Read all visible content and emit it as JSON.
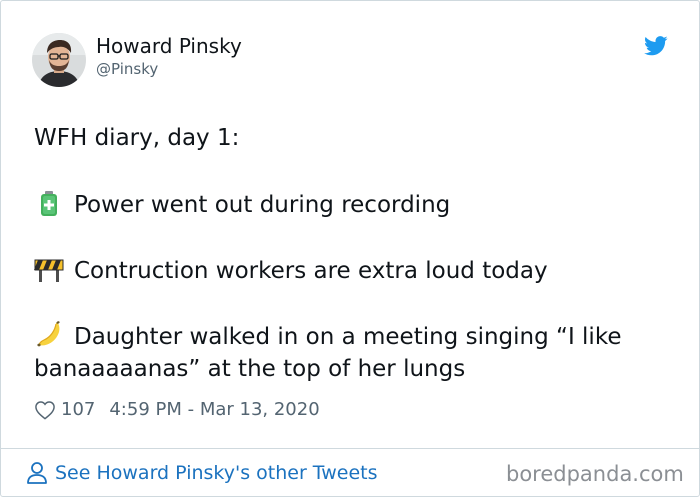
{
  "author": {
    "name": "Howard Pinsky",
    "handle": "@Pinsky"
  },
  "tweet": {
    "lines": [
      "WFH diary, day 1:",
      "Power went out during recording",
      "Contruction workers are extra loud today",
      "Daughter walked in on a meeting singing “I like",
      "banaaaaanas” at the top of her lungs"
    ],
    "emoji_icons": [
      "battery-icon",
      "construction-barrier-icon",
      "banana-icon"
    ]
  },
  "meta": {
    "likes": "107",
    "timestamp": "4:59 PM - Mar 13, 2020"
  },
  "footer": {
    "link_text": "See Howard Pinsky's other Tweets"
  },
  "watermark": "boredpanda.com",
  "colors": {
    "twitter_blue": "#1d9bf0",
    "link_blue": "#1b72bf",
    "text": "#0f1419",
    "muted": "#536471",
    "border": "#cfd9de"
  }
}
